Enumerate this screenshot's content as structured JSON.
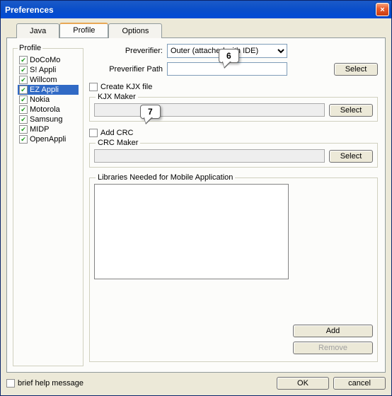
{
  "window": {
    "title": "Preferences",
    "close_icon": "×"
  },
  "tabs": {
    "java": "Java",
    "profile": "Profile",
    "options": "Options"
  },
  "profile": {
    "legend": "Profile",
    "items": [
      "DoCoMo",
      "S! Appli",
      "Willcom",
      "EZ Appli",
      "Nokia",
      "Motorola",
      "Samsung",
      "MIDP",
      "OpenAppli"
    ],
    "selected_index": 3
  },
  "preverifier": {
    "label": "Preverifier:",
    "value": "Outer (attached with IDE)",
    "path_label": "Preverifier Path",
    "path_value": "",
    "select": "Select"
  },
  "kjx": {
    "create_label": "Create KJX file",
    "group": "KJX Maker",
    "select": "Select"
  },
  "crc": {
    "add_label": "Add CRC",
    "group": "CRC Maker",
    "select": "Select"
  },
  "libs": {
    "group": "Libraries Needed for Mobile Application",
    "add": "Add",
    "remove": "Remove"
  },
  "footer": {
    "brief": "brief help message",
    "ok": "OK",
    "cancel": "cancel"
  },
  "callouts": {
    "c6": "6",
    "c7": "7"
  }
}
